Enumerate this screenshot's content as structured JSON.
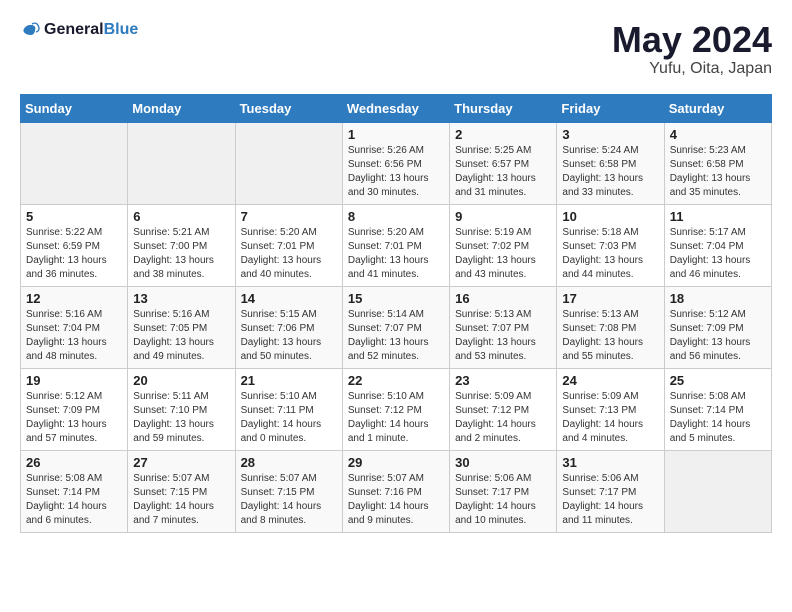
{
  "header": {
    "logo_line1": "General",
    "logo_line2": "Blue",
    "month": "May 2024",
    "location": "Yufu, Oita, Japan"
  },
  "weekdays": [
    "Sunday",
    "Monday",
    "Tuesday",
    "Wednesday",
    "Thursday",
    "Friday",
    "Saturday"
  ],
  "weeks": [
    [
      {
        "day": "",
        "info": ""
      },
      {
        "day": "",
        "info": ""
      },
      {
        "day": "",
        "info": ""
      },
      {
        "day": "1",
        "info": "Sunrise: 5:26 AM\nSunset: 6:56 PM\nDaylight: 13 hours\nand 30 minutes."
      },
      {
        "day": "2",
        "info": "Sunrise: 5:25 AM\nSunset: 6:57 PM\nDaylight: 13 hours\nand 31 minutes."
      },
      {
        "day": "3",
        "info": "Sunrise: 5:24 AM\nSunset: 6:58 PM\nDaylight: 13 hours\nand 33 minutes."
      },
      {
        "day": "4",
        "info": "Sunrise: 5:23 AM\nSunset: 6:58 PM\nDaylight: 13 hours\nand 35 minutes."
      }
    ],
    [
      {
        "day": "5",
        "info": "Sunrise: 5:22 AM\nSunset: 6:59 PM\nDaylight: 13 hours\nand 36 minutes."
      },
      {
        "day": "6",
        "info": "Sunrise: 5:21 AM\nSunset: 7:00 PM\nDaylight: 13 hours\nand 38 minutes."
      },
      {
        "day": "7",
        "info": "Sunrise: 5:20 AM\nSunset: 7:01 PM\nDaylight: 13 hours\nand 40 minutes."
      },
      {
        "day": "8",
        "info": "Sunrise: 5:20 AM\nSunset: 7:01 PM\nDaylight: 13 hours\nand 41 minutes."
      },
      {
        "day": "9",
        "info": "Sunrise: 5:19 AM\nSunset: 7:02 PM\nDaylight: 13 hours\nand 43 minutes."
      },
      {
        "day": "10",
        "info": "Sunrise: 5:18 AM\nSunset: 7:03 PM\nDaylight: 13 hours\nand 44 minutes."
      },
      {
        "day": "11",
        "info": "Sunrise: 5:17 AM\nSunset: 7:04 PM\nDaylight: 13 hours\nand 46 minutes."
      }
    ],
    [
      {
        "day": "12",
        "info": "Sunrise: 5:16 AM\nSunset: 7:04 PM\nDaylight: 13 hours\nand 48 minutes."
      },
      {
        "day": "13",
        "info": "Sunrise: 5:16 AM\nSunset: 7:05 PM\nDaylight: 13 hours\nand 49 minutes."
      },
      {
        "day": "14",
        "info": "Sunrise: 5:15 AM\nSunset: 7:06 PM\nDaylight: 13 hours\nand 50 minutes."
      },
      {
        "day": "15",
        "info": "Sunrise: 5:14 AM\nSunset: 7:07 PM\nDaylight: 13 hours\nand 52 minutes."
      },
      {
        "day": "16",
        "info": "Sunrise: 5:13 AM\nSunset: 7:07 PM\nDaylight: 13 hours\nand 53 minutes."
      },
      {
        "day": "17",
        "info": "Sunrise: 5:13 AM\nSunset: 7:08 PM\nDaylight: 13 hours\nand 55 minutes."
      },
      {
        "day": "18",
        "info": "Sunrise: 5:12 AM\nSunset: 7:09 PM\nDaylight: 13 hours\nand 56 minutes."
      }
    ],
    [
      {
        "day": "19",
        "info": "Sunrise: 5:12 AM\nSunset: 7:09 PM\nDaylight: 13 hours\nand 57 minutes."
      },
      {
        "day": "20",
        "info": "Sunrise: 5:11 AM\nSunset: 7:10 PM\nDaylight: 13 hours\nand 59 minutes."
      },
      {
        "day": "21",
        "info": "Sunrise: 5:10 AM\nSunset: 7:11 PM\nDaylight: 14 hours\nand 0 minutes."
      },
      {
        "day": "22",
        "info": "Sunrise: 5:10 AM\nSunset: 7:12 PM\nDaylight: 14 hours\nand 1 minute."
      },
      {
        "day": "23",
        "info": "Sunrise: 5:09 AM\nSunset: 7:12 PM\nDaylight: 14 hours\nand 2 minutes."
      },
      {
        "day": "24",
        "info": "Sunrise: 5:09 AM\nSunset: 7:13 PM\nDaylight: 14 hours\nand 4 minutes."
      },
      {
        "day": "25",
        "info": "Sunrise: 5:08 AM\nSunset: 7:14 PM\nDaylight: 14 hours\nand 5 minutes."
      }
    ],
    [
      {
        "day": "26",
        "info": "Sunrise: 5:08 AM\nSunset: 7:14 PM\nDaylight: 14 hours\nand 6 minutes."
      },
      {
        "day": "27",
        "info": "Sunrise: 5:07 AM\nSunset: 7:15 PM\nDaylight: 14 hours\nand 7 minutes."
      },
      {
        "day": "28",
        "info": "Sunrise: 5:07 AM\nSunset: 7:15 PM\nDaylight: 14 hours\nand 8 minutes."
      },
      {
        "day": "29",
        "info": "Sunrise: 5:07 AM\nSunset: 7:16 PM\nDaylight: 14 hours\nand 9 minutes."
      },
      {
        "day": "30",
        "info": "Sunrise: 5:06 AM\nSunset: 7:17 PM\nDaylight: 14 hours\nand 10 minutes."
      },
      {
        "day": "31",
        "info": "Sunrise: 5:06 AM\nSunset: 7:17 PM\nDaylight: 14 hours\nand 11 minutes."
      },
      {
        "day": "",
        "info": ""
      }
    ]
  ]
}
